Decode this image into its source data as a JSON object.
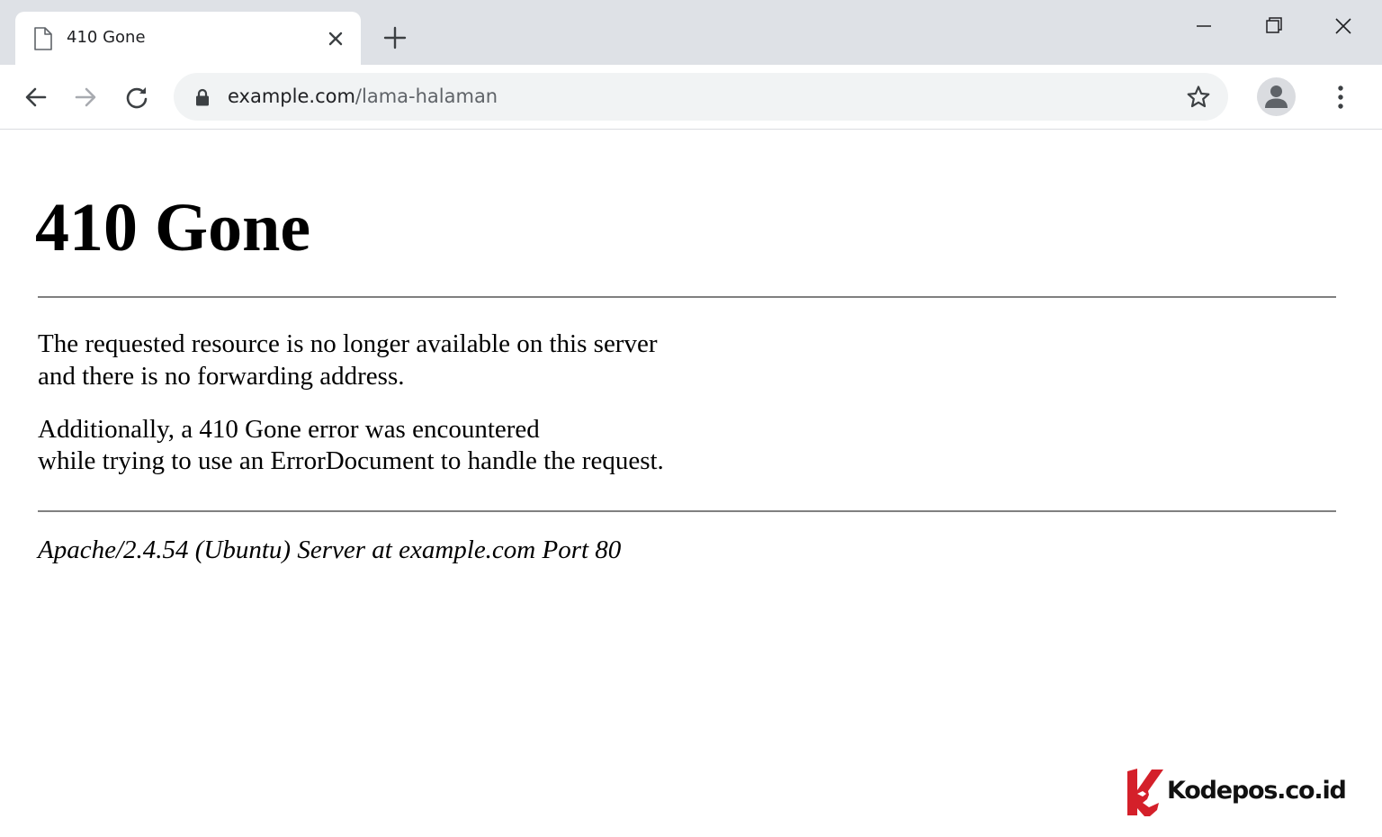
{
  "browser": {
    "tab": {
      "title": "410 Gone",
      "favicon": "page-icon"
    },
    "address_bar": {
      "host": "example.com",
      "path": "/lama-halaman"
    },
    "icons": {
      "new_tab": "plus-icon",
      "minimize": "minimize-icon",
      "restore": "restore-icon",
      "close": "close-icon",
      "back": "arrow-left-icon",
      "forward": "arrow-right-icon",
      "reload": "reload-icon",
      "lock": "lock-icon",
      "bookmark": "star-icon",
      "profile": "person-icon",
      "menu": "kebab-menu-icon"
    },
    "colors": {
      "titlebar": "#dee1e6",
      "omnibox": "#f1f3f4",
      "text": "#202124",
      "muted": "#5f6368"
    }
  },
  "page": {
    "title": "410 Gone",
    "paragraph_1": {
      "line_1": "The requested resource is no longer available on this server",
      "line_2": "and there is no forwarding address."
    },
    "paragraph_2": {
      "line_1": "Additionally, a 410 Gone error was encountered",
      "line_2": "while trying to use an ErrorDocument to handle the request."
    },
    "server_signature": "Apache/2.4.54 (Ubuntu) Server at example.com Port 80"
  },
  "watermark": {
    "text": "Kodepos.co.id",
    "logo_color": "#d4202a"
  }
}
